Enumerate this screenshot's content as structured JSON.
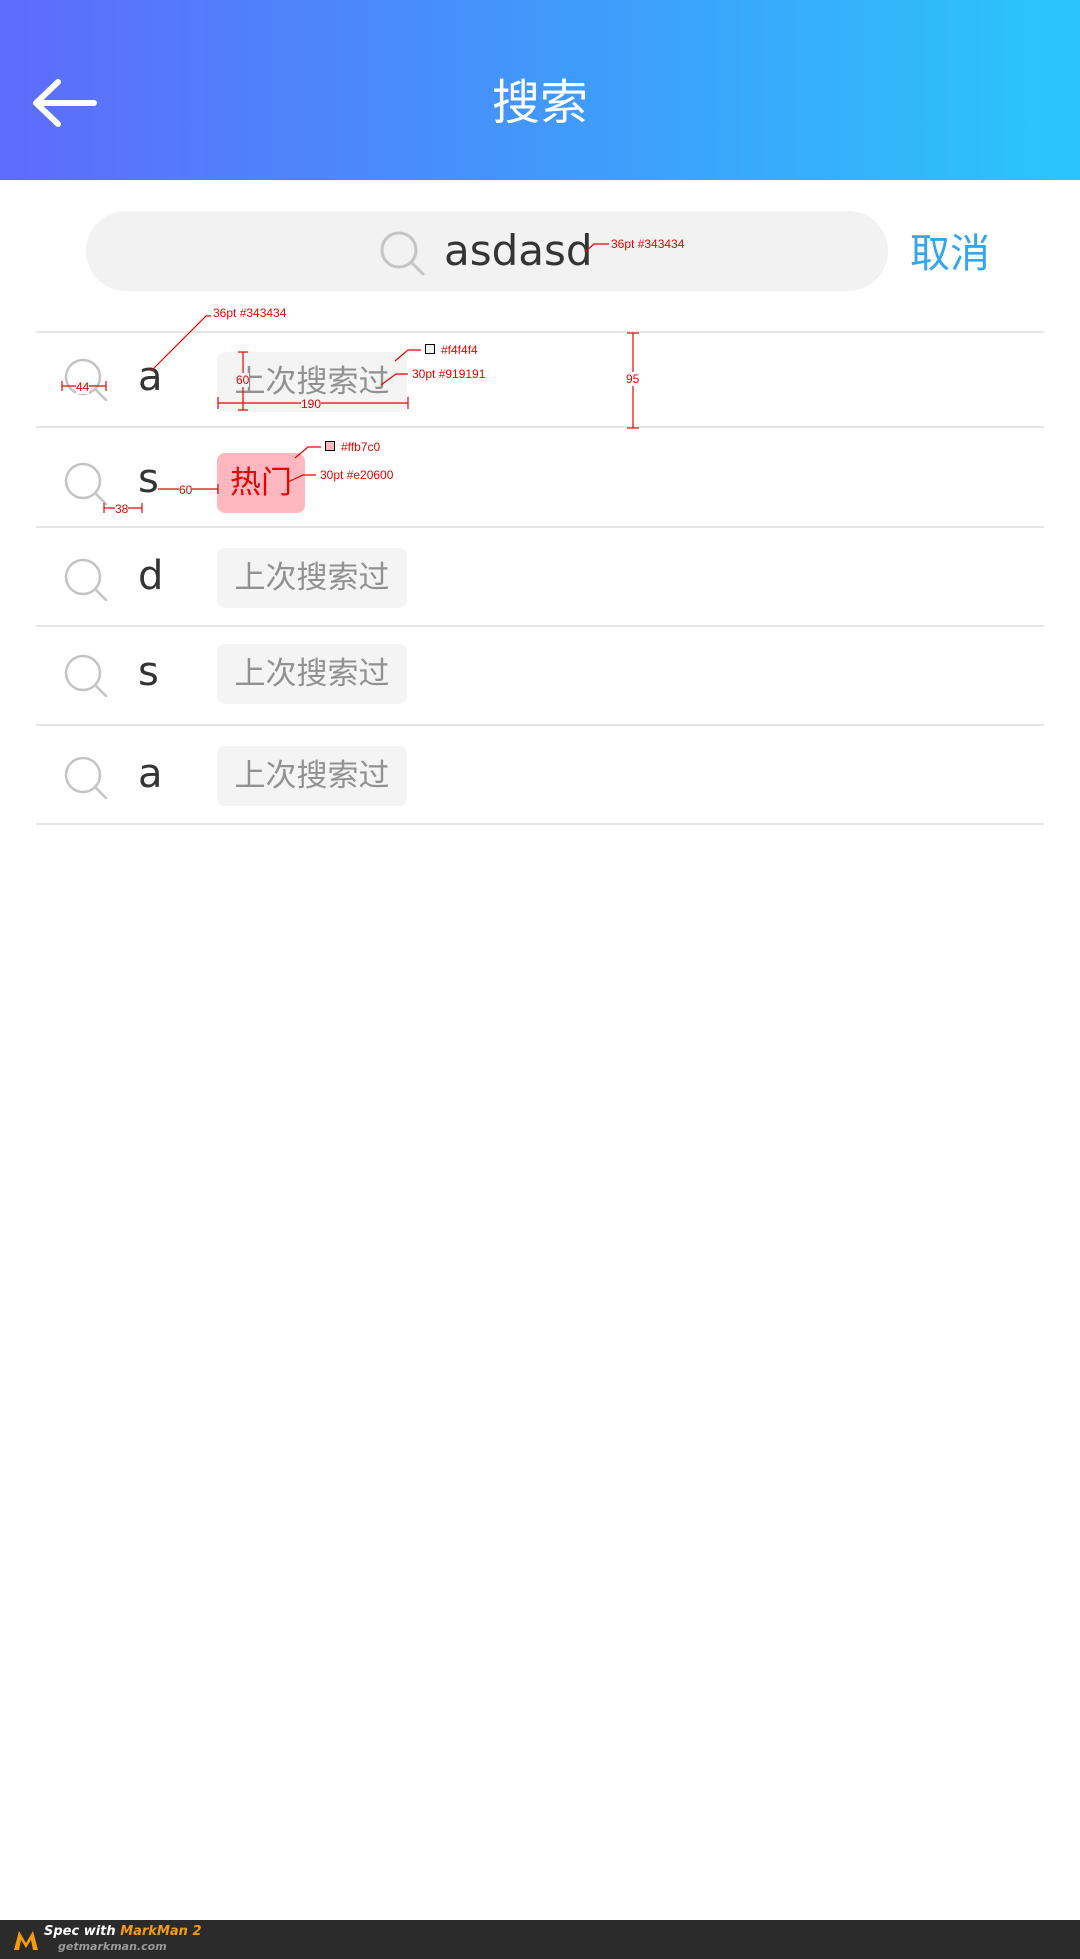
{
  "header": {
    "title": "搜索",
    "back_icon": "arrow-left-icon"
  },
  "search": {
    "query": "asdasd",
    "icon": "search-icon",
    "cancel_label": "取消"
  },
  "history": [
    {
      "text": "a",
      "tag": "上次搜索过",
      "tag_type": "history"
    },
    {
      "text": "s",
      "tag": "热门",
      "tag_type": "hot"
    },
    {
      "text": "d",
      "tag": "上次搜索过",
      "tag_type": "history"
    },
    {
      "text": "s",
      "tag": "上次搜索过",
      "tag_type": "history"
    },
    {
      "text": "a",
      "tag": "上次搜索过",
      "tag_type": "history"
    }
  ],
  "annotations": {
    "search_text_spec": "36pt #343434",
    "row_text_spec": "36pt #343434",
    "tag_bg_color": "#f4f4f4",
    "tag_text_spec": "30pt #919191",
    "tag_height": "60",
    "tag_width": "190",
    "row_height": "95",
    "icon_size": "44",
    "icon_gap": "38",
    "text_gap": "60",
    "hot_bg_color": "#ffb7c0",
    "hot_text_spec": "30pt #e20600"
  },
  "footer": {
    "line1_prefix": "Spec with ",
    "line1_brand": "MarkMan 2",
    "line2": "getmarkman.com"
  },
  "colors": {
    "header_gradient_start": "#5e6bfb",
    "header_gradient_end": "#2ac6fb",
    "cancel": "#33a6ee",
    "text": "#343434",
    "tag_text": "#919191",
    "tag_bg": "#f4f4f4",
    "hot_bg": "#ffb7c0",
    "hot_text": "#e20600"
  }
}
